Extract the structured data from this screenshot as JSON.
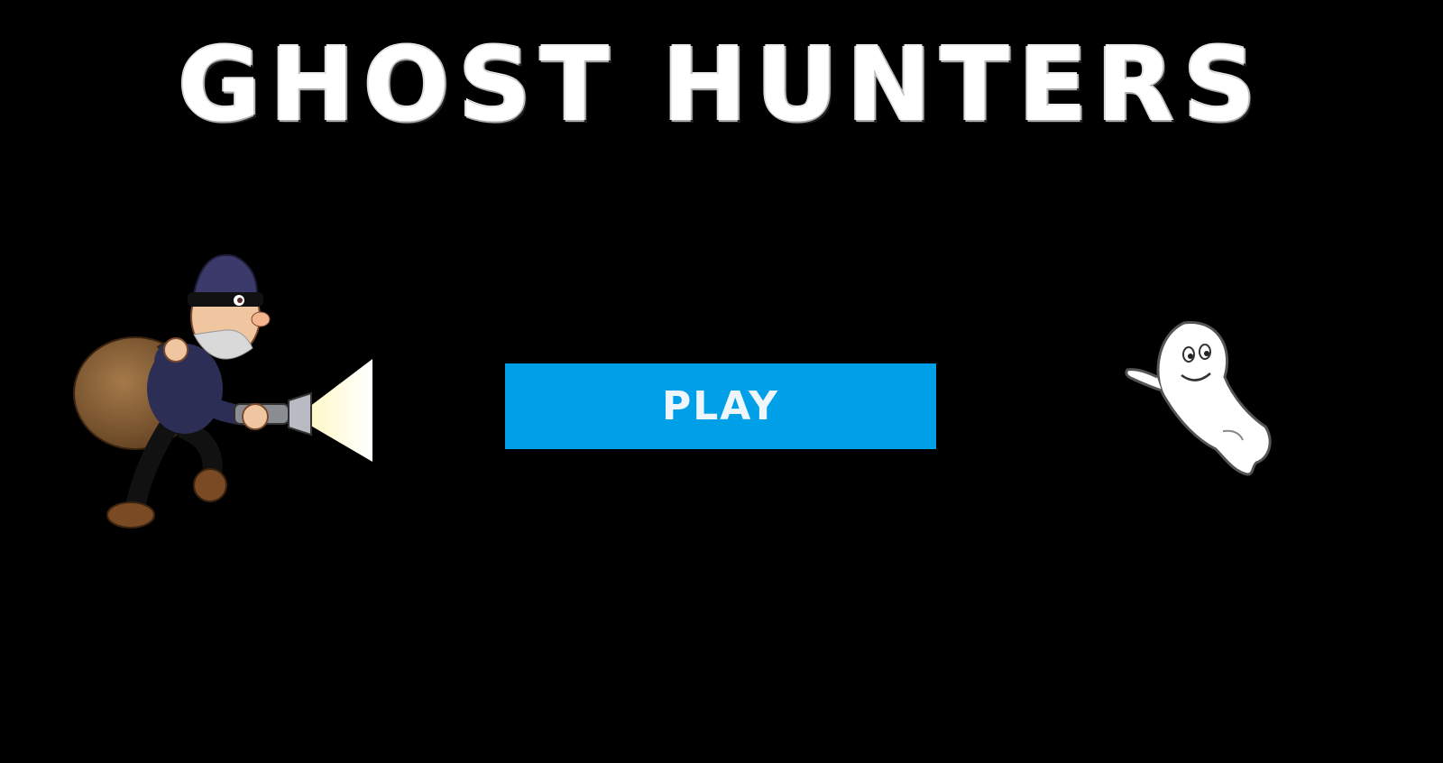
{
  "title": "GHOST HUNTERS",
  "play_button": {
    "label": "PLAY"
  },
  "colors": {
    "background": "#000000",
    "title": "#ffffff",
    "play_button": "#00a0e9"
  },
  "sprites": {
    "left": "thief-with-flashlight-sprite",
    "right": "ghost-sprite"
  }
}
